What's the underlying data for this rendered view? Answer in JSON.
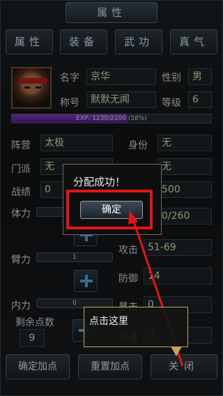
{
  "title": "属性",
  "tabs": [
    "属性",
    "装备",
    "武功",
    "真气"
  ],
  "profile": {
    "name_label": "名字",
    "name": "京华",
    "gender_label": "性别",
    "gender": "男",
    "nickname_label": "称号",
    "nickname": "默默无闻",
    "level_label": "等级",
    "level": "6"
  },
  "exp": {
    "text": "EXP: 1230/2100  (58%)",
    "fill_fraction": 0.58
  },
  "info": {
    "camp_label": "阵营",
    "camp": "太极",
    "identity_label": "身份",
    "identity": "无",
    "sect_label": "门派",
    "sect": "无",
    "row2_right": "无",
    "merit_label": "战绩",
    "merit": "0",
    "row3_right": "500"
  },
  "stats": {
    "stamina_label": "体力",
    "arm_label": "臂力",
    "arm_value": "1",
    "inner_label": "内力",
    "inner_value": "0",
    "hp_value": "0/260",
    "attack_label": "攻击",
    "attack": "51-69",
    "defense_label": "防御",
    "defense": "14",
    "crit_label": "暴击",
    "crit": "0",
    "speed_label": "攻速",
    "speed": "0"
  },
  "remaining": {
    "label": "剩余点数",
    "value": "9"
  },
  "buttons": {
    "confirm": "确定加点",
    "reset": "重置加点",
    "close": "关闭"
  },
  "dialog": {
    "message": "分配成功！",
    "ok": "确定"
  },
  "hint": {
    "text": "点击这里"
  },
  "colors": {
    "highlight": "#e01616",
    "exp_bar": "#8a3cc0",
    "plus_icon": "#5ba3d8"
  }
}
